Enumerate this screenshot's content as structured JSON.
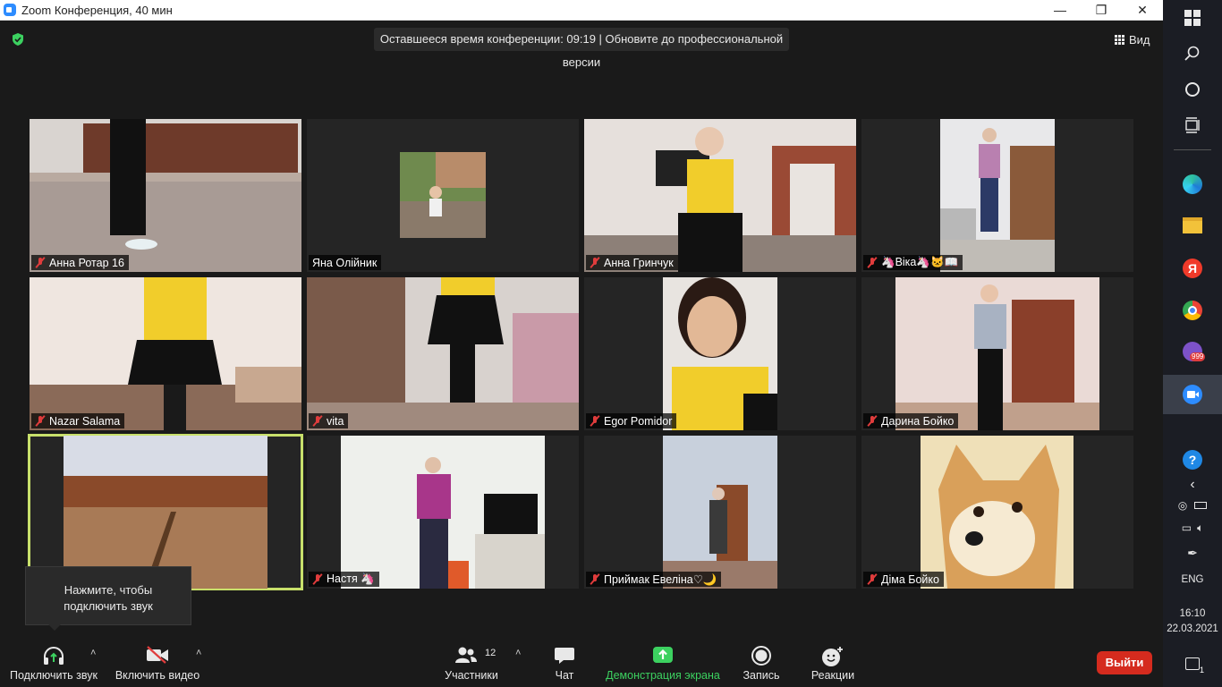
{
  "window": {
    "title": "Zoom Конференция, 40 мин",
    "minimize_glyph": "—",
    "maximize_glyph": "❐",
    "close_glyph": "✕"
  },
  "meeting": {
    "timer_text": "Оставшееся время конференции: 09:19 | Обновите до профессиональной версии",
    "view_label": "Вид",
    "security_color": "#3cd160",
    "active_speaker_color": "#c8e06b"
  },
  "participants": [
    {
      "name": "Анна  Ротар 16",
      "muted": true
    },
    {
      "name": "Яна Олійник",
      "muted": false
    },
    {
      "name": "Анна Гринчук",
      "muted": true
    },
    {
      "name": "🦄Віка🦄🐱📖",
      "muted": true
    },
    {
      "name": "Nazar Salama",
      "muted": true
    },
    {
      "name": "vita",
      "muted": true
    },
    {
      "name": "Egor Pomidor",
      "muted": true
    },
    {
      "name": "Дарина Бойко",
      "muted": true
    },
    {
      "name": "",
      "muted": false,
      "active": true
    },
    {
      "name": "Настя 🦄",
      "muted": true
    },
    {
      "name": "Приймак Евеліна♡🌙",
      "muted": true
    },
    {
      "name": "Діма Бойко",
      "muted": true
    }
  ],
  "tooltip": {
    "line1": "Нажмите, чтобы",
    "line2": "подключить звук"
  },
  "toolbar": {
    "audio_label": "Подключить звук",
    "video_label": "Включить видео",
    "participants_label": "Участники",
    "participants_count": "12",
    "chat_label": "Чат",
    "share_label": "Демонстрация экрана",
    "record_label": "Запись",
    "reactions_label": "Реакции",
    "leave_label": "Выйти",
    "share_color": "#3cd160",
    "leave_color": "#d52b1e"
  },
  "taskbar": {
    "language": "ENG",
    "time": "16:10",
    "date": "22.03.2021",
    "viber_badge": "999",
    "notifications_count": "1",
    "apps": [
      "windows-start",
      "search",
      "cortana",
      "task-view",
      "edge",
      "file-explorer",
      "yandex-browser",
      "chrome",
      "viber",
      "zoom"
    ]
  }
}
